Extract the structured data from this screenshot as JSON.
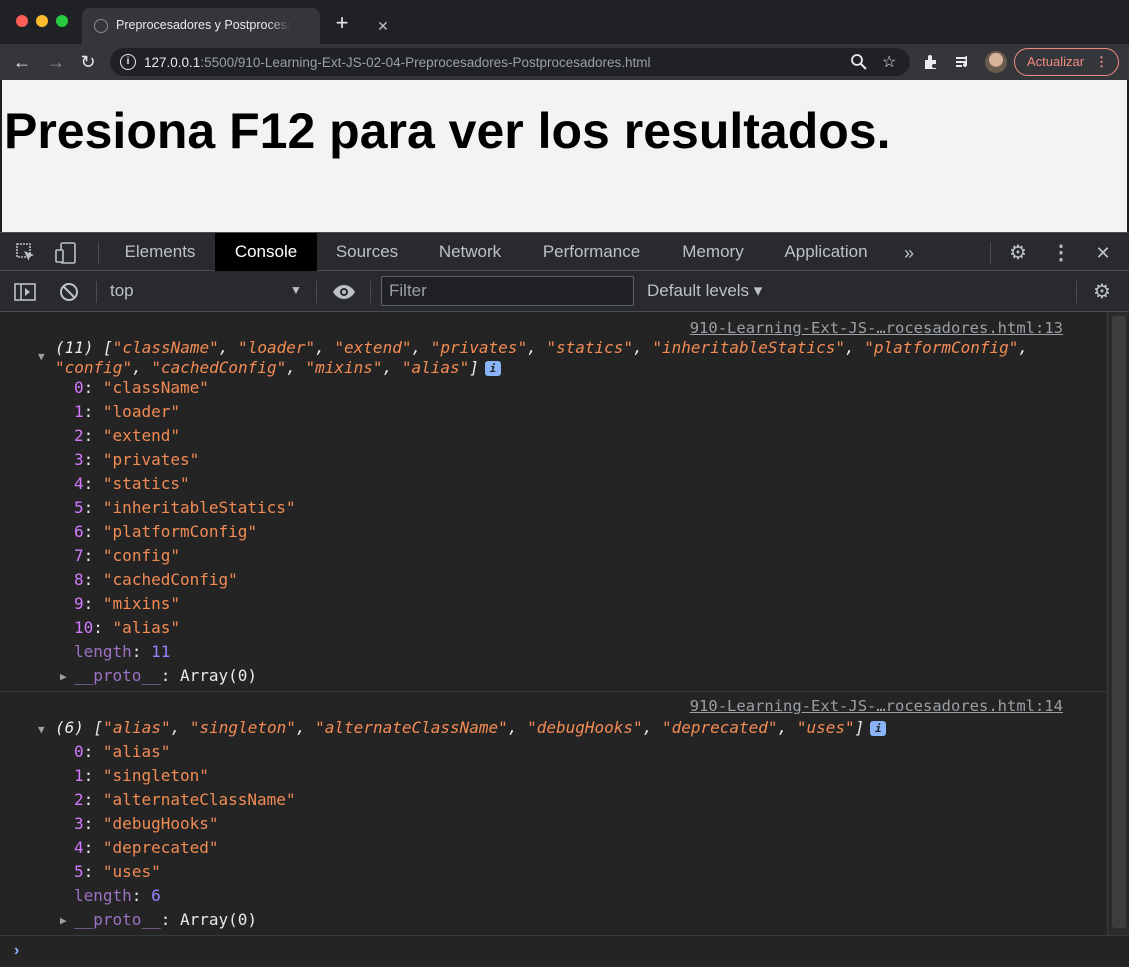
{
  "browser": {
    "tab_title": "Preprocesadores y Postprocesadores",
    "tab_close": "✕",
    "new_tab": "+",
    "url_host": "127.0.0.1",
    "url_rest": ":5500/910-Learning-Ext-JS-02-04-Preprocesadores-Postprocesadores.html",
    "update_label": "Actualizar",
    "update_menu": "⋮",
    "icons": [
      "back-arrow-icon",
      "forward-arrow-icon",
      "reload-icon",
      "info-icon",
      "zoom-icon",
      "star-icon",
      "extensions-icon",
      "media-icon",
      "avatar"
    ]
  },
  "page": {
    "heading": "Presiona F12 para ver los resultados."
  },
  "devtools": {
    "tabs": [
      {
        "label": "Elements",
        "active": false
      },
      {
        "label": "Console",
        "active": true
      },
      {
        "label": "Sources",
        "active": false
      },
      {
        "label": "Network",
        "active": false
      },
      {
        "label": "Performance",
        "active": false
      },
      {
        "label": "Memory",
        "active": false
      },
      {
        "label": "Application",
        "active": false
      }
    ],
    "more_tabs": "»",
    "context": "top",
    "filter_placeholder": "Filter",
    "levels_label": "Default levels ▾",
    "colors": {
      "string": "#f28b54",
      "index": "#d27aff",
      "number": "#9980ff",
      "link": "#9aa0a6",
      "active_tab_bg": "#000000"
    }
  },
  "console": {
    "messages": [
      {
        "source": "910-Learning-Ext-JS-…rocesadores.html:13",
        "count": "(11)",
        "items": [
          "className",
          "loader",
          "extend",
          "privates",
          "statics",
          "inheritableStatics",
          "platformConfig",
          "config",
          "cachedConfig",
          "mixins",
          "alias"
        ],
        "length": "11",
        "proto": "Array(0)"
      },
      {
        "source": "910-Learning-Ext-JS-…rocesadores.html:14",
        "count": "(6)",
        "items": [
          "alias",
          "singleton",
          "alternateClassName",
          "debugHooks",
          "deprecated",
          "uses"
        ],
        "length": "6",
        "proto": "Array(0)"
      }
    ],
    "prompt": "›"
  }
}
